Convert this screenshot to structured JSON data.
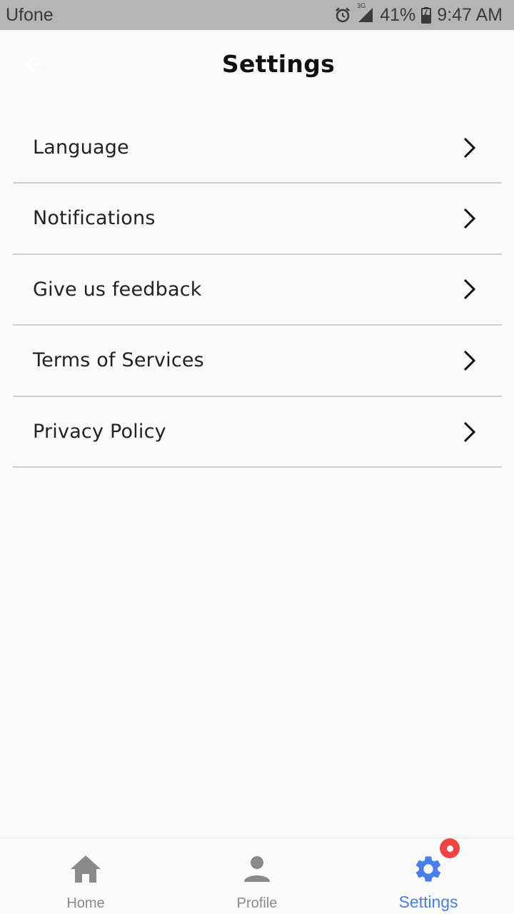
{
  "status_bar": {
    "carrier": "Ufone",
    "network": "3G",
    "battery": "41%",
    "time": "9:47 AM",
    "icons": [
      "alarm-icon",
      "signal-icon",
      "battery-icon"
    ]
  },
  "header": {
    "title": "Settings",
    "back_icon": "arrow-left-icon"
  },
  "settings": {
    "items": [
      {
        "label": "Language"
      },
      {
        "label": "Notifications"
      },
      {
        "label": "Give us feedback"
      },
      {
        "label": "Terms of Services"
      },
      {
        "label": "Privacy Policy"
      }
    ]
  },
  "bottom_nav": {
    "items": [
      {
        "label": "Home",
        "icon": "home-icon",
        "active": false
      },
      {
        "label": "Profile",
        "icon": "person-icon",
        "active": false
      },
      {
        "label": "Settings",
        "icon": "gear-icon",
        "active": true,
        "badge": true
      }
    ]
  },
  "colors": {
    "status_bar_bg": "#b5b5b5",
    "background": "#fafafa",
    "divider": "#cfcfcf",
    "accent": "#4a7ee8",
    "badge": "#ef4444",
    "inactive": "#8a8a8a"
  }
}
